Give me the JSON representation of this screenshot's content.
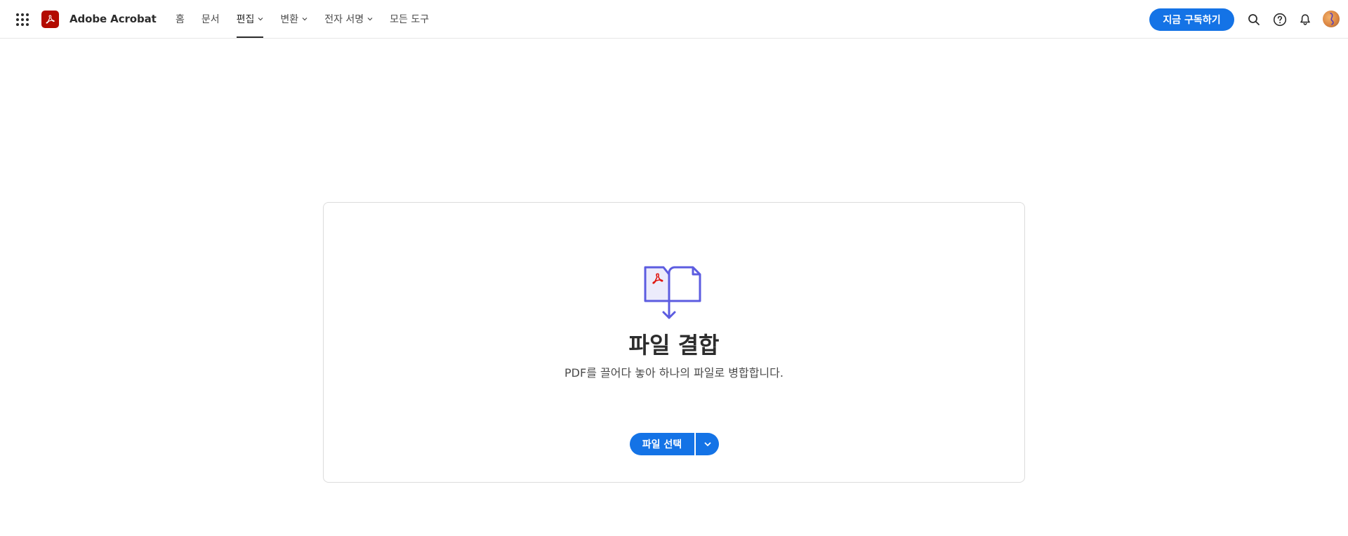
{
  "header": {
    "brand_name": "Adobe Acrobat",
    "nav": [
      {
        "label": "홈",
        "has_dropdown": false,
        "active": false
      },
      {
        "label": "문서",
        "has_dropdown": false,
        "active": false
      },
      {
        "label": "편집",
        "has_dropdown": true,
        "active": true
      },
      {
        "label": "변환",
        "has_dropdown": true,
        "active": false
      },
      {
        "label": "전자 서명",
        "has_dropdown": true,
        "active": false
      },
      {
        "label": "모든 도구",
        "has_dropdown": false,
        "active": false
      }
    ],
    "subscribe_label": "지금 구독하기"
  },
  "main": {
    "title": "파일 결합",
    "subtitle": "PDF를 끌어다 놓아 하나의 파일로 병합합니다.",
    "select_button_label": "파일 선택"
  },
  "colors": {
    "accent": "#1473e6",
    "brand": "#b30b00",
    "illustration": "#5c5ce0"
  },
  "icons": {
    "app_switcher": "app-grid-icon",
    "search": "search-icon",
    "help": "help-icon",
    "notifications": "bell-icon"
  }
}
